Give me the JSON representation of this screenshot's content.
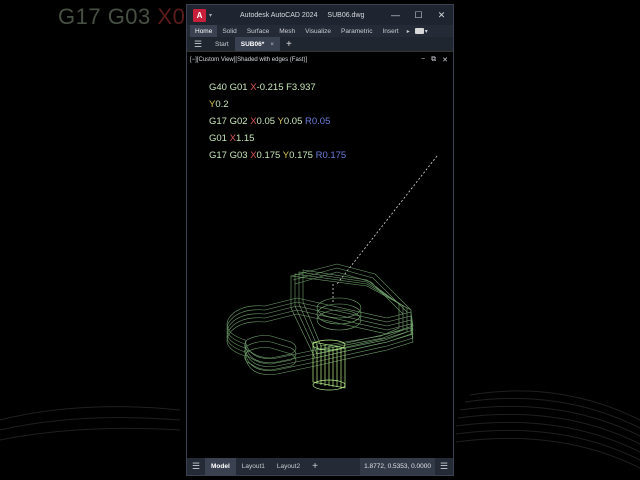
{
  "backdrop": {
    "text_prefix": "G17 G03 ",
    "text_x": "X0",
    "colors": {
      "bg": "#000000"
    }
  },
  "window": {
    "logo": "A",
    "app_name": "Autodesk AutoCAD 2024",
    "file_name": "SUB06.dwg",
    "icons": {
      "minimize": "minimize-icon",
      "maximize": "maximize-icon",
      "close": "close-icon"
    }
  },
  "ribbon": {
    "tabs": [
      "Home",
      "Solid",
      "Surface",
      "Mesh",
      "Visualize",
      "Parametric",
      "Insert"
    ],
    "active_tab": "Home"
  },
  "doc_tabs": {
    "start": "Start",
    "active": "SUB06*",
    "close": "×",
    "new": "+"
  },
  "viewport": {
    "label": "[−][Custom View][Shaded with edges (Fast)]",
    "controls": [
      "−",
      "⧉",
      "✕"
    ]
  },
  "gcode": {
    "line1": {
      "a": "G40 G01 ",
      "x": "X",
      "xv": "-0.215 ",
      "f": "F3.937"
    },
    "line2": {
      "y": "Y",
      "yv": "0.2"
    },
    "line3": {
      "a": "G17 G02 ",
      "x": "X",
      "xv": "0.05 ",
      "y": "Y",
      "yv": "0.05 ",
      "r": "R",
      "rv": "0.05"
    },
    "line4": {
      "a": "G01 ",
      "x": "X",
      "xv": "1.15"
    },
    "line5": {
      "a": "G17 G03 ",
      "x": "X",
      "xv": "0.175 ",
      "y": "Y",
      "yv": "0.175 ",
      "r": "R",
      "rv": "0.175"
    }
  },
  "statusbar": {
    "tabs": [
      "Model",
      "Layout1",
      "Layout2"
    ],
    "active": "Model",
    "add": "+",
    "coords": "1.8772, 0.5353, 0.0000"
  }
}
